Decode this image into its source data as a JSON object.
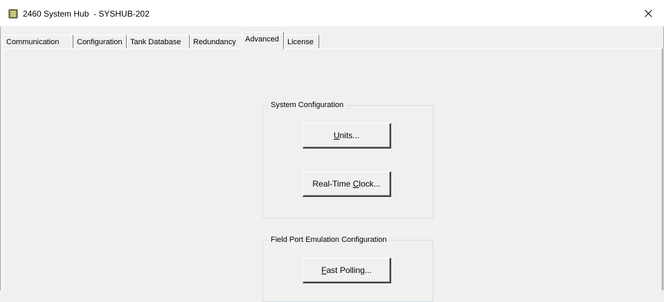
{
  "window": {
    "title": "2460 System Hub  - SYSHUB-202",
    "icon": "app-database-icon",
    "close_icon": "close-icon"
  },
  "tabs": [
    {
      "label": "Communication",
      "active": false
    },
    {
      "label": "Configuration",
      "active": false
    },
    {
      "label": "Tank Database",
      "active": false
    },
    {
      "label": "Redundancy",
      "active": false
    },
    {
      "label": "Advanced",
      "active": true
    },
    {
      "label": "License",
      "active": false
    }
  ],
  "system_configuration": {
    "title": "System Configuration",
    "units_button": {
      "mnemonic": "U",
      "rest": "nits..."
    },
    "clock_button": {
      "prefix": "Real-Time ",
      "mnemonic": "C",
      "rest": "lock..."
    }
  },
  "field_port": {
    "title": "Field Port Emulation Configuration",
    "fast_polling_button": {
      "mnemonic": "F",
      "rest": "ast Polling..."
    }
  },
  "colors": {
    "title_bar": "#ffffff",
    "dialog_background": "#f0f0f0",
    "group_border": "#d5dfe5"
  }
}
